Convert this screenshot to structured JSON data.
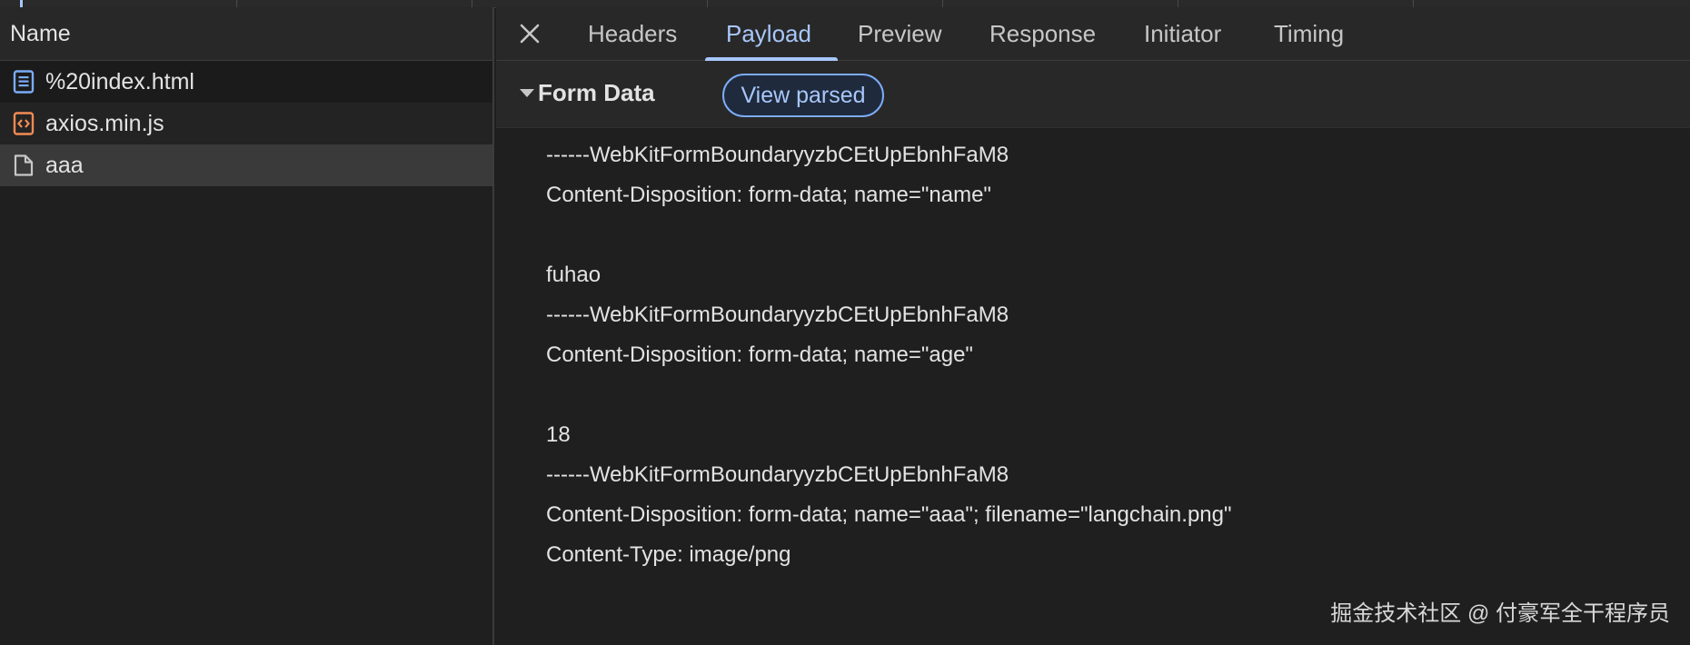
{
  "request_list": {
    "column_header": "Name",
    "items": [
      {
        "name": "%20index.html",
        "icon": "document-icon",
        "icon_color": "#7cacf8"
      },
      {
        "name": "axios.min.js",
        "icon": "script-icon",
        "icon_color": "#f28b54"
      },
      {
        "name": "aaa",
        "icon": "file-icon",
        "icon_color": "#c7c7c7",
        "selected": true
      }
    ]
  },
  "detail": {
    "close_label": "×",
    "tabs": [
      {
        "label": "Headers"
      },
      {
        "label": "Payload",
        "active": true
      },
      {
        "label": "Preview"
      },
      {
        "label": "Response"
      },
      {
        "label": "Initiator"
      },
      {
        "label": "Timing"
      }
    ],
    "section": {
      "title": "Form Data",
      "button_label": "View parsed"
    },
    "payload_lines": [
      "------WebKitFormBoundaryyzbCEtUpEbnhFaM8",
      "Content-Disposition: form-data; name=\"name\"",
      "",
      "fuhao",
      "------WebKitFormBoundaryyzbCEtUpEbnhFaM8",
      "Content-Disposition: form-data; name=\"age\"",
      "",
      "18",
      "------WebKitFormBoundaryyzbCEtUpEbnhFaM8",
      "Content-Disposition: form-data; name=\"aaa\"; filename=\"langchain.png\"",
      "Content-Type: image/png"
    ]
  },
  "watermark": "掘金技术社区 @ 付豪军全干程序员",
  "colors": {
    "accent": "#a8c7fa",
    "panel_bg": "#1f1f1f",
    "header_bg": "#282828",
    "selected_row": "#3a3a3a"
  }
}
